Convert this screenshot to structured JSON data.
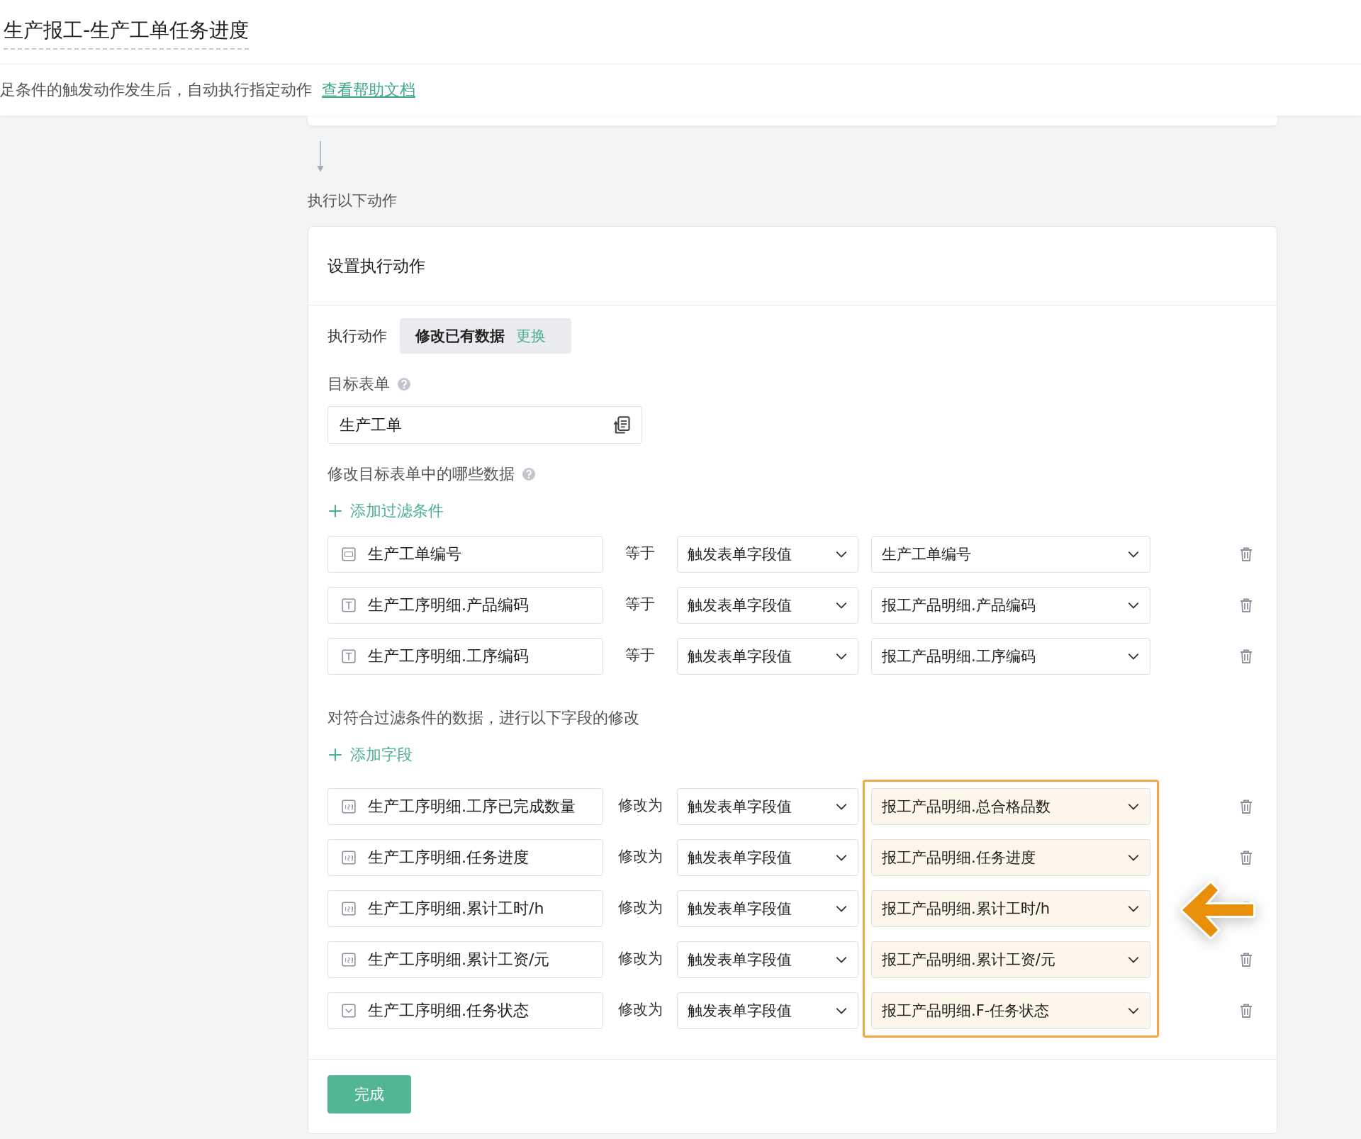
{
  "header": {
    "title": "生产报工-生产工单任务进度"
  },
  "description": {
    "text": "足条件的触发动作发生后，自动执行指定动作",
    "link": "查看帮助文档"
  },
  "section_label": "执行以下动作",
  "card": {
    "title": "设置执行动作",
    "action": {
      "label": "执行动作",
      "value": "修改已有数据",
      "change": "更换"
    },
    "target": {
      "label": "目标表单",
      "value": "生产工单"
    },
    "filter": {
      "label": "修改目标表单中的哪些数据",
      "add": "添加过滤条件",
      "rows": [
        {
          "kind": "serial",
          "field": "生产工单编号",
          "operator": "等于",
          "source": "触发表单字段值",
          "value": "生产工单编号"
        },
        {
          "kind": "text",
          "field": "生产工序明细.产品编码",
          "operator": "等于",
          "source": "触发表单字段值",
          "value": "报工产品明细.产品编码"
        },
        {
          "kind": "text",
          "field": "生产工序明细.工序编码",
          "operator": "等于",
          "source": "触发表单字段值",
          "value": "报工产品明细.工序编码"
        }
      ]
    },
    "update": {
      "label": "对符合过滤条件的数据，进行以下字段的修改",
      "add": "添加字段",
      "rows": [
        {
          "kind": "number",
          "field": "生产工序明细.工序已完成数量",
          "operator": "修改为",
          "source": "触发表单字段值",
          "value": "报工产品明细.总合格品数"
        },
        {
          "kind": "number",
          "field": "生产工序明细.任务进度",
          "operator": "修改为",
          "source": "触发表单字段值",
          "value": "报工产品明细.任务进度"
        },
        {
          "kind": "number",
          "field": "生产工序明细.累计工时/h",
          "operator": "修改为",
          "source": "触发表单字段值",
          "value": "报工产品明细.累计工时/h"
        },
        {
          "kind": "number",
          "field": "生产工序明细.累计工资/元",
          "operator": "修改为",
          "source": "触发表单字段值",
          "value": "报工产品明细.累计工资/元"
        },
        {
          "kind": "select",
          "field": "生产工序明细.任务状态",
          "operator": "修改为",
          "source": "触发表单字段值",
          "value": "报工产品明细.F-任务状态"
        }
      ]
    },
    "submit": "完成"
  }
}
